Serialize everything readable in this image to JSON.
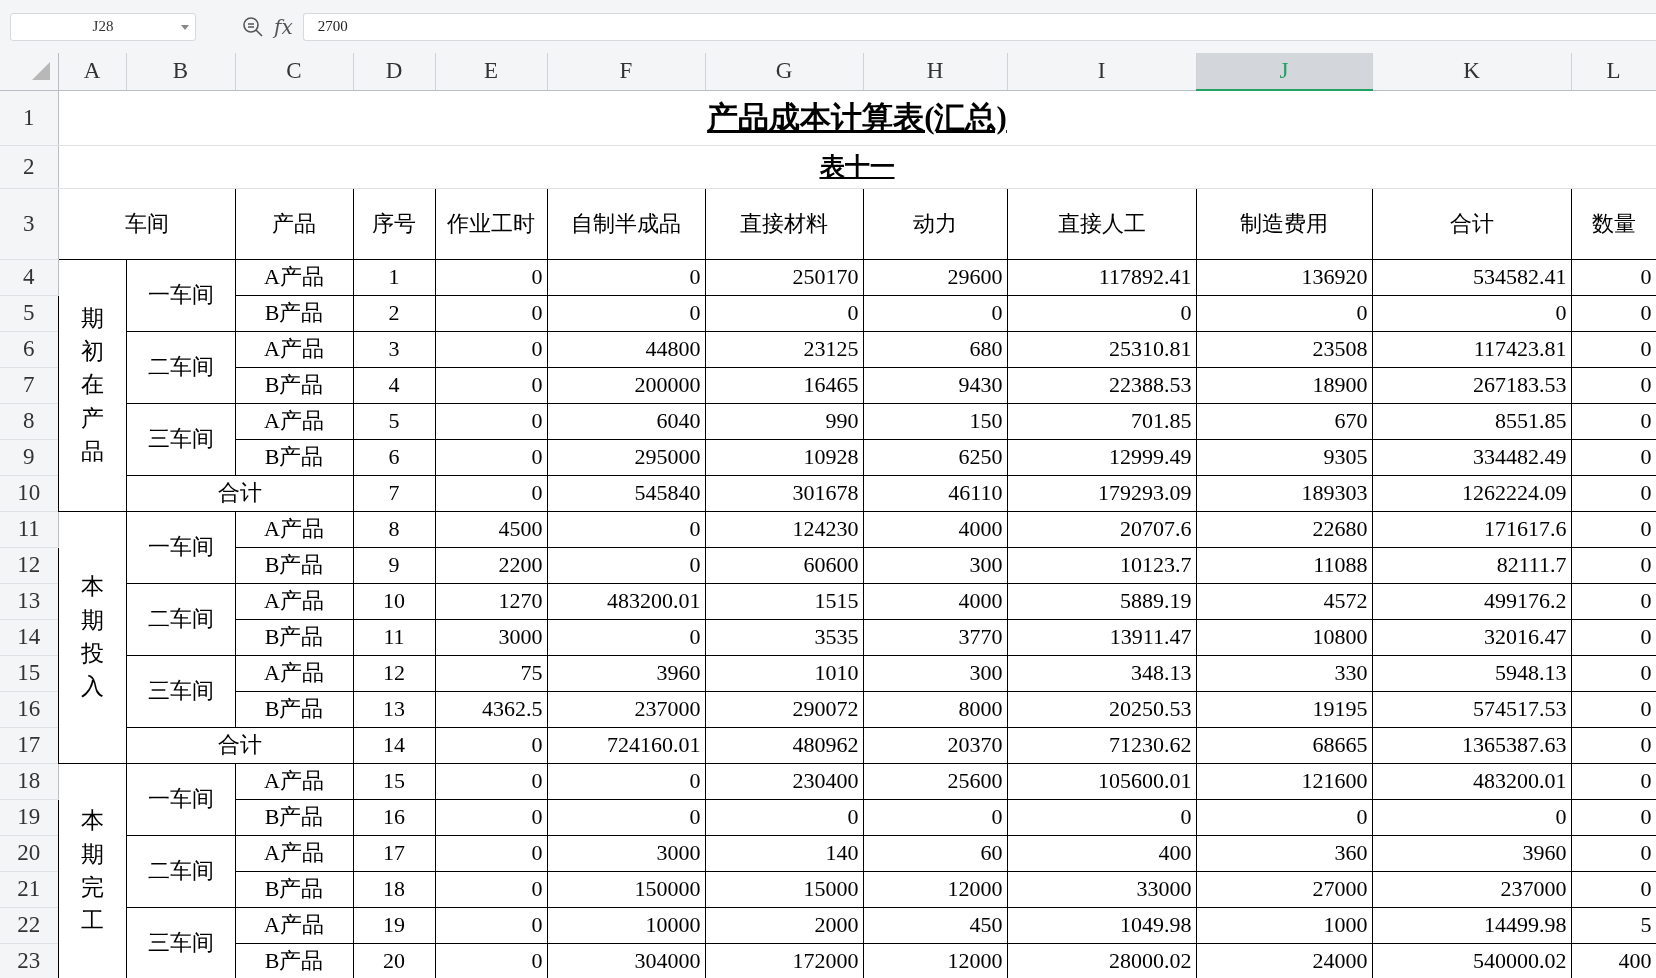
{
  "formula_bar": {
    "cell_ref": "J28",
    "function_label": "fx",
    "value": "2700"
  },
  "columns": [
    {
      "label": "A",
      "selected": false
    },
    {
      "label": "B",
      "selected": false
    },
    {
      "label": "C",
      "selected": false
    },
    {
      "label": "D",
      "selected": false
    },
    {
      "label": "E",
      "selected": false
    },
    {
      "label": "F",
      "selected": false
    },
    {
      "label": "G",
      "selected": false
    },
    {
      "label": "H",
      "selected": false
    },
    {
      "label": "I",
      "selected": false
    },
    {
      "label": "J",
      "selected": true
    },
    {
      "label": "K",
      "selected": false
    },
    {
      "label": "L",
      "selected": false
    }
  ],
  "row_numbers": [
    "1",
    "2",
    "3",
    "4",
    "5",
    "6",
    "7",
    "8",
    "9",
    "10",
    "11",
    "12",
    "13",
    "14",
    "15",
    "16",
    "17",
    "18",
    "19",
    "20",
    "21",
    "22",
    "23"
  ],
  "title": "产品成本计算表(汇总)",
  "subtitle": "表十一",
  "header": {
    "group": "车间",
    "cells": [
      "产品",
      "序号",
      "作业工时",
      "自制半成品",
      "直接材料",
      "动力",
      "直接人工",
      "制造费用",
      "合计",
      "数量"
    ]
  },
  "sections": [
    {
      "label": "期初在产品",
      "workshops": [
        {
          "name": "一车间",
          "rows": [
            {
              "product": "A产品",
              "seq": "1",
              "values": [
                "0",
                "0",
                "250170",
                "29600",
                "117892.41",
                "136920",
                "534582.41",
                "0"
              ]
            },
            {
              "product": "B产品",
              "seq": "2",
              "values": [
                "0",
                "0",
                "0",
                "0",
                "0",
                "0",
                "0",
                "0"
              ]
            }
          ]
        },
        {
          "name": "二车间",
          "rows": [
            {
              "product": "A产品",
              "seq": "3",
              "values": [
                "0",
                "44800",
                "23125",
                "680",
                "25310.81",
                "23508",
                "117423.81",
                "0"
              ]
            },
            {
              "product": "B产品",
              "seq": "4",
              "values": [
                "0",
                "200000",
                "16465",
                "9430",
                "22388.53",
                "18900",
                "267183.53",
                "0"
              ]
            }
          ]
        },
        {
          "name": "三车间",
          "rows": [
            {
              "product": "A产品",
              "seq": "5",
              "values": [
                "0",
                "6040",
                "990",
                "150",
                "701.85",
                "670",
                "8551.85",
                "0"
              ]
            },
            {
              "product": "B产品",
              "seq": "6",
              "values": [
                "0",
                "295000",
                "10928",
                "6250",
                "12999.49",
                "9305",
                "334482.49",
                "0"
              ]
            }
          ]
        }
      ],
      "total": {
        "label": "合计",
        "seq": "7",
        "values": [
          "0",
          "545840",
          "301678",
          "46110",
          "179293.09",
          "189303",
          "1262224.09",
          "0"
        ]
      }
    },
    {
      "label": "本期投入",
      "workshops": [
        {
          "name": "一车间",
          "rows": [
            {
              "product": "A产品",
              "seq": "8",
              "values": [
                "4500",
                "0",
                "124230",
                "4000",
                "20707.6",
                "22680",
                "171617.6",
                "0"
              ]
            },
            {
              "product": "B产品",
              "seq": "9",
              "values": [
                "2200",
                "0",
                "60600",
                "300",
                "10123.7",
                "11088",
                "82111.7",
                "0"
              ]
            }
          ]
        },
        {
          "name": "二车间",
          "rows": [
            {
              "product": "A产品",
              "seq": "10",
              "values": [
                "1270",
                "483200.01",
                "1515",
                "4000",
                "5889.19",
                "4572",
                "499176.2",
                "0"
              ]
            },
            {
              "product": "B产品",
              "seq": "11",
              "values": [
                "3000",
                "0",
                "3535",
                "3770",
                "13911.47",
                "10800",
                "32016.47",
                "0"
              ]
            }
          ]
        },
        {
          "name": "三车间",
          "rows": [
            {
              "product": "A产品",
              "seq": "12",
              "values": [
                "75",
                "3960",
                "1010",
                "300",
                "348.13",
                "330",
                "5948.13",
                "0"
              ]
            },
            {
              "product": "B产品",
              "seq": "13",
              "values": [
                "4362.5",
                "237000",
                "290072",
                "8000",
                "20250.53",
                "19195",
                "574517.53",
                "0"
              ]
            }
          ]
        }
      ],
      "total": {
        "label": "合计",
        "seq": "14",
        "values": [
          "0",
          "724160.01",
          "480962",
          "20370",
          "71230.62",
          "68665",
          "1365387.63",
          "0"
        ]
      }
    },
    {
      "label": "本期完工",
      "workshops": [
        {
          "name": "一车间",
          "rows": [
            {
              "product": "A产品",
              "seq": "15",
              "values": [
                "0",
                "0",
                "230400",
                "25600",
                "105600.01",
                "121600",
                "483200.01",
                "0"
              ]
            },
            {
              "product": "B产品",
              "seq": "16",
              "values": [
                "0",
                "0",
                "0",
                "0",
                "0",
                "0",
                "0",
                "0"
              ]
            }
          ]
        },
        {
          "name": "二车间",
          "rows": [
            {
              "product": "A产品",
              "seq": "17",
              "values": [
                "0",
                "3000",
                "140",
                "60",
                "400",
                "360",
                "3960",
                "0"
              ]
            },
            {
              "product": "B产品",
              "seq": "18",
              "values": [
                "0",
                "150000",
                "15000",
                "12000",
                "33000",
                "27000",
                "237000",
                "0"
              ]
            }
          ]
        },
        {
          "name": "三车间",
          "rows": [
            {
              "product": "A产品",
              "seq": "19",
              "values": [
                "0",
                "10000",
                "2000",
                "450",
                "1049.98",
                "1000",
                "14499.98",
                "5"
              ]
            },
            {
              "product": "B产品",
              "seq": "20",
              "values": [
                "0",
                "304000",
                "172000",
                "12000",
                "28000.02",
                "24000",
                "540000.02",
                "400"
              ]
            }
          ]
        }
      ]
    }
  ]
}
